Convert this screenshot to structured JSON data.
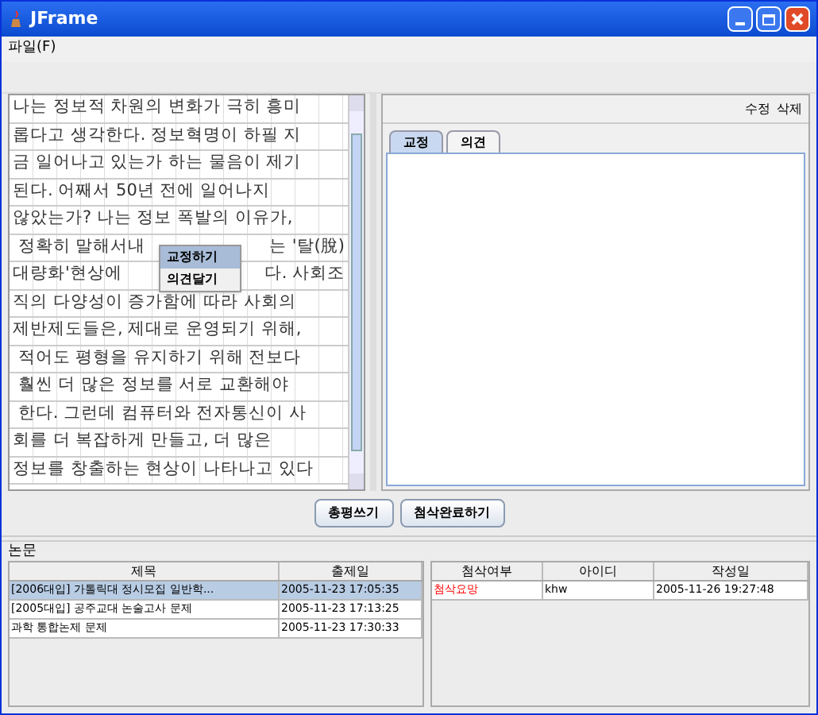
{
  "window": {
    "title": "JFrame"
  },
  "menu": [
    {
      "label": "파일(F)"
    }
  ],
  "manuscript": {
    "lines": [
      [
        "나는 정보적 차원의 변화가 극히 흥미"
      ],
      [
        "롭다고 생각한다. 정보혁명이 하필 지"
      ],
      [
        "금 일어나고 있는가 하는 물음이 제기"
      ],
      [
        "된다. 어째서 50년 전에 일어나지"
      ],
      [
        "않았는가? 나는 정보 폭발의 이유가,"
      ],
      [
        " 정확히 말해서내",
        "는 '탈(脫)"
      ],
      [
        "대량화'현상에",
        "다. 사회조"
      ],
      [
        "직의 다양성이 증가함에 따라 사회의"
      ],
      [
        "제반제도들은, 제대로 운영되기 위해,"
      ],
      [
        " 적어도 평형을 유지하기 위해 전보다"
      ],
      [
        " 훨씬 더 많은 정보를 서로 교환해야"
      ],
      [
        " 한다. 그런데 컴퓨터와 전자통신이 사"
      ],
      [
        "회를 더 복잡하게 만들고, 더 많은"
      ],
      [
        "정보를 창출하는 현상이 나타나고 있다"
      ]
    ]
  },
  "context_menu": [
    {
      "label": "교정하기",
      "selected": true
    },
    {
      "label": "의견달기",
      "selected": false
    }
  ],
  "edit_actions": [
    "수정",
    "삭제"
  ],
  "tabs": [
    {
      "label": "교정",
      "selected": true
    },
    {
      "label": "의견",
      "selected": false
    }
  ],
  "buttons": [
    "총평쓰기",
    "첨삭완료하기"
  ],
  "papers": {
    "title": "논문",
    "columns": [
      "제목",
      "출제일"
    ],
    "rows": [
      {
        "cells": [
          "[2006대입] 가톨릭대 정시모집 일반학...",
          "2005-11-23 17:05:35"
        ],
        "selected": true
      },
      {
        "cells": [
          "[2005대입] 공주교대 논술고사 문제",
          "2005-11-23 17:13:25"
        ],
        "selected": false
      },
      {
        "cells": [
          "과학 통합논제 문제",
          "2005-11-23 17:30:33"
        ],
        "selected": false
      }
    ]
  },
  "reviews": {
    "columns": [
      "첨삭여부",
      "아이디",
      "작성일"
    ],
    "rows": [
      {
        "cells": [
          "첨삭요망",
          "khw",
          "2005-11-26 19:27:48"
        ],
        "selected": false,
        "color": "#ff0000"
      }
    ]
  }
}
